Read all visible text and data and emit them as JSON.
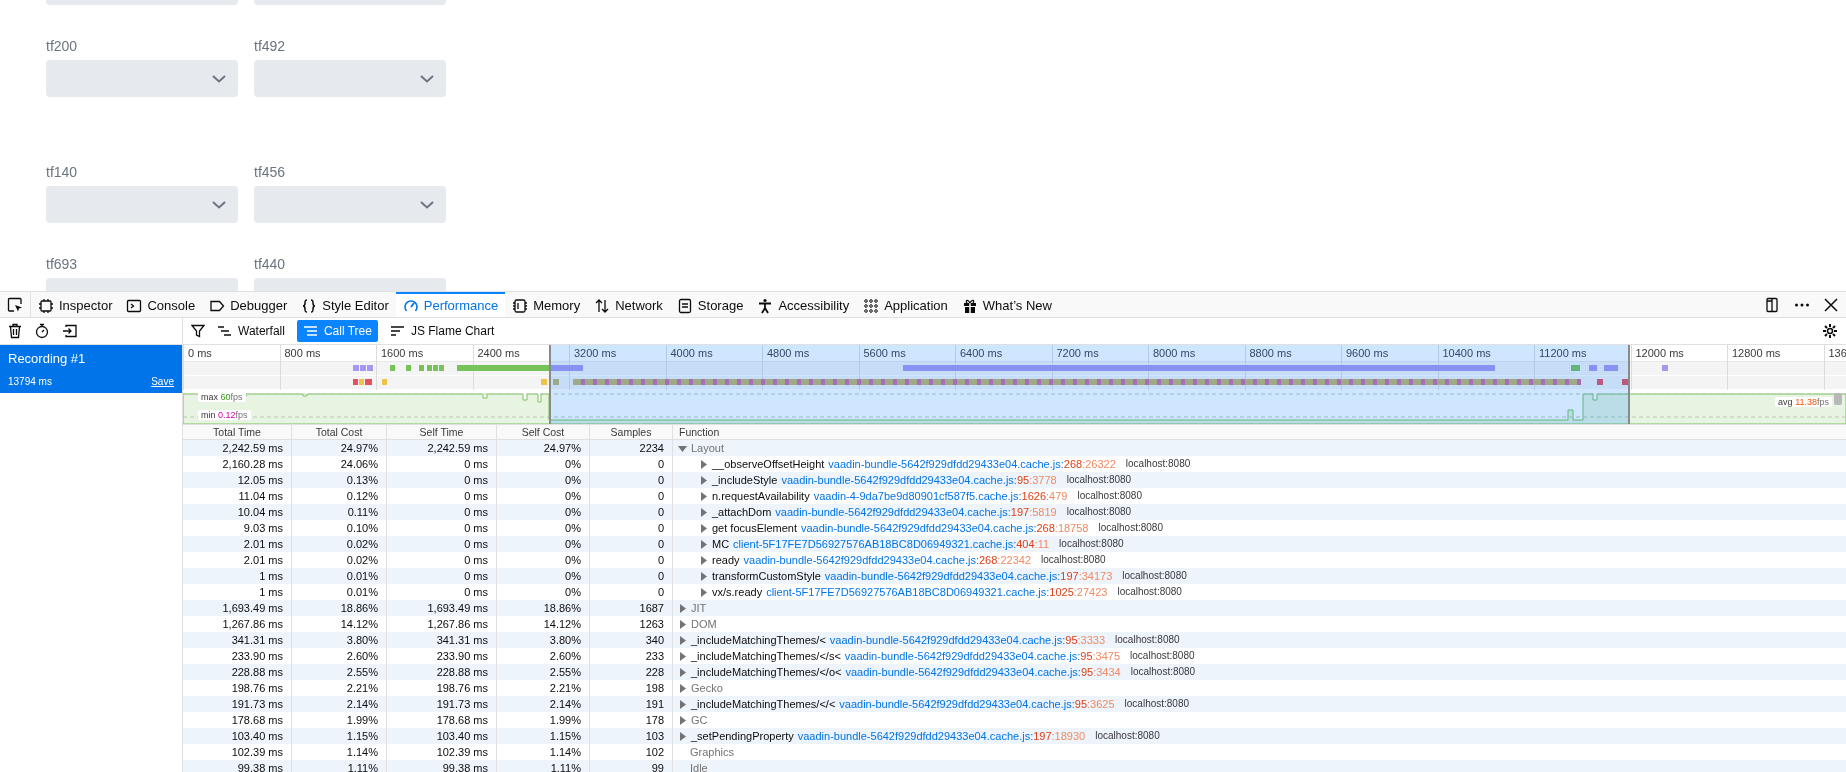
{
  "form": {
    "rows": [
      {
        "fields": [
          {
            "kind": "combo_edge"
          },
          {
            "kind": "combo_edge"
          }
        ]
      },
      {
        "fields": [
          {
            "kind": "combo",
            "label": "tf200"
          },
          {
            "kind": "combo",
            "label": "tf492"
          }
        ]
      },
      {
        "fields": [
          {
            "kind": "combo",
            "label": "tf140"
          },
          {
            "kind": "combo",
            "label": "tf456"
          }
        ]
      },
      {
        "fields": [
          {
            "kind": "combo_edge",
            "label": "tf693"
          },
          {
            "kind": "combo_edge",
            "label": "tf440"
          }
        ]
      }
    ]
  },
  "devtools": {
    "tabs": [
      {
        "label": "Inspector",
        "selected": false
      },
      {
        "label": "Console",
        "selected": false
      },
      {
        "label": "Debugger",
        "selected": false
      },
      {
        "label": "Style Editor",
        "selected": false
      },
      {
        "label": "Performance",
        "selected": true
      },
      {
        "label": "Memory",
        "selected": false
      },
      {
        "label": "Network",
        "selected": false
      },
      {
        "label": "Storage",
        "selected": false
      },
      {
        "label": "Accessibility",
        "selected": false
      },
      {
        "label": "Application",
        "selected": false
      },
      {
        "label": "What’s New",
        "selected": false
      }
    ],
    "recordings": [
      {
        "name": "Recording #1",
        "duration": "13794 ms",
        "action": "Save",
        "selected": true
      }
    ],
    "views": [
      {
        "label": "Waterfall",
        "selected": false
      },
      {
        "label": "Call Tree",
        "selected": true
      },
      {
        "label": "JS Flame Chart",
        "selected": false
      }
    ],
    "timeline": {
      "ticks": [
        "0 ms",
        "800 ms",
        "1600 ms",
        "2400 ms",
        "3200 ms",
        "4000 ms",
        "4800 ms",
        "5600 ms",
        "6400 ms",
        "7200 ms",
        "8000 ms",
        "8800 ms",
        "9600 ms",
        "10400 ms",
        "11200 ms",
        "12000 ms",
        "12800 ms",
        "136"
      ],
      "fps": {
        "max": {
          "label": "max",
          "value": "60",
          "unit": "fps"
        },
        "min": {
          "label": "min",
          "value": "0.12",
          "unit": "fps"
        },
        "avg": {
          "label": "avg",
          "value": "11.38",
          "unit": "fps"
        }
      }
    },
    "call_tree": {
      "columns": [
        "Total Time",
        "Total Cost",
        "Self Time",
        "Self Cost",
        "Samples",
        "Function"
      ],
      "rows": [
        {
          "kind": "category",
          "name": "Layout",
          "expanded": true,
          "total_time": "2,242.59 ms",
          "total_cost": "24.97%",
          "self_time": "2,242.59 ms",
          "self_cost": "24.97%",
          "samples": "2234",
          "children": [
            {
              "kind": "function",
              "name": "__observeOffsetHeight",
              "expanded": false,
              "total_time": "2,160.28 ms",
              "total_cost": "24.06%",
              "self_time": "0 ms",
              "self_cost": "0%",
              "samples": "0",
              "source": "vaadin-bundle-5642f929dfdd29433e04.cache.js:268:26322",
              "host": "localhost:8080"
            },
            {
              "kind": "function",
              "name": "_includeStyle",
              "expanded": false,
              "total_time": "12.05 ms",
              "total_cost": "0.13%",
              "self_time": "0 ms",
              "self_cost": "0%",
              "samples": "0",
              "source": "vaadin-bundle-5642f929dfdd29433e04.cache.js:95:3778",
              "host": "localhost:8080"
            },
            {
              "kind": "function",
              "name": "n.requestAvailability",
              "expanded": false,
              "total_time": "11.04 ms",
              "total_cost": "0.12%",
              "self_time": "0 ms",
              "self_cost": "0%",
              "samples": "0",
              "source": "vaadin-4-9da7be9d80901cf587f5.cache.js:1626:479",
              "host": "localhost:8080"
            },
            {
              "kind": "function",
              "name": "_attachDom",
              "expanded": false,
              "total_time": "10.04 ms",
              "total_cost": "0.11%",
              "self_time": "0 ms",
              "self_cost": "0%",
              "samples": "0",
              "source": "vaadin-bundle-5642f929dfdd29433e04.cache.js:197:5819",
              "host": "localhost:8080"
            },
            {
              "kind": "function",
              "name": "get focusElement",
              "expanded": false,
              "total_time": "9.03 ms",
              "total_cost": "0.10%",
              "self_time": "0 ms",
              "self_cost": "0%",
              "samples": "0",
              "source": "vaadin-bundle-5642f929dfdd29433e04.cache.js:268:18758",
              "host": "localhost:8080"
            },
            {
              "kind": "function",
              "name": "MC",
              "expanded": false,
              "total_time": "2.01 ms",
              "total_cost": "0.02%",
              "self_time": "0 ms",
              "self_cost": "0%",
              "samples": "0",
              "source": "client-5F17FE7D56927576AB18BC8D06949321.cache.js:404:11",
              "host": "localhost:8080"
            },
            {
              "kind": "function",
              "name": "ready",
              "expanded": false,
              "total_time": "2.01 ms",
              "total_cost": "0.02%",
              "self_time": "0 ms",
              "self_cost": "0%",
              "samples": "0",
              "source": "vaadin-bundle-5642f929dfdd29433e04.cache.js:268:22342",
              "host": "localhost:8080"
            },
            {
              "kind": "function",
              "name": "transformCustomStyle",
              "expanded": false,
              "total_time": "1 ms",
              "total_cost": "0.01%",
              "self_time": "0 ms",
              "self_cost": "0%",
              "samples": "0",
              "source": "vaadin-bundle-5642f929dfdd29433e04.cache.js:197:34173",
              "host": "localhost:8080"
            },
            {
              "kind": "function",
              "name": "vx/s.ready",
              "expanded": false,
              "total_time": "1 ms",
              "total_cost": "0.01%",
              "self_time": "0 ms",
              "self_cost": "0%",
              "samples": "0",
              "source": "client-5F17FE7D56927576AB18BC8D06949321.cache.js:1025:27423",
              "host": "localhost:8080"
            }
          ]
        },
        {
          "kind": "category",
          "name": "JIT",
          "expanded": false,
          "total_time": "1,693.49 ms",
          "total_cost": "18.86%",
          "self_time": "1,693.49 ms",
          "self_cost": "18.86%",
          "samples": "1687"
        },
        {
          "kind": "category",
          "name": "DOM",
          "expanded": false,
          "total_time": "1,267.86 ms",
          "total_cost": "14.12%",
          "self_time": "1,267.86 ms",
          "self_cost": "14.12%",
          "samples": "1263"
        },
        {
          "kind": "function",
          "name": "_includeMatchingThemes/<",
          "expanded": false,
          "total_time": "341.31 ms",
          "total_cost": "3.80%",
          "self_time": "341.31 ms",
          "self_cost": "3.80%",
          "samples": "340",
          "source": "vaadin-bundle-5642f929dfdd29433e04.cache.js:95:3333",
          "host": "localhost:8080"
        },
        {
          "kind": "function",
          "name": "_includeMatchingThemes/</s<",
          "expanded": false,
          "total_time": "233.90 ms",
          "total_cost": "2.60%",
          "self_time": "233.90 ms",
          "self_cost": "2.60%",
          "samples": "233",
          "source": "vaadin-bundle-5642f929dfdd29433e04.cache.js:95:3475",
          "host": "localhost:8080"
        },
        {
          "kind": "function",
          "name": "_includeMatchingThemes/</o<",
          "expanded": false,
          "total_time": "228.88 ms",
          "total_cost": "2.55%",
          "self_time": "228.88 ms",
          "self_cost": "2.55%",
          "samples": "228",
          "source": "vaadin-bundle-5642f929dfdd29433e04.cache.js:95:3434",
          "host": "localhost:8080"
        },
        {
          "kind": "category",
          "name": "Gecko",
          "expanded": false,
          "total_time": "198.76 ms",
          "total_cost": "2.21%",
          "self_time": "198.76 ms",
          "self_cost": "2.21%",
          "samples": "198"
        },
        {
          "kind": "function",
          "name": "_includeMatchingThemes/</<",
          "expanded": false,
          "total_time": "191.73 ms",
          "total_cost": "2.14%",
          "self_time": "191.73 ms",
          "self_cost": "2.14%",
          "samples": "191",
          "source": "vaadin-bundle-5642f929dfdd29433e04.cache.js:95:3625",
          "host": "localhost:8080"
        },
        {
          "kind": "category",
          "name": "GC",
          "expanded": false,
          "total_time": "178.68 ms",
          "total_cost": "1.99%",
          "self_time": "178.68 ms",
          "self_cost": "1.99%",
          "samples": "178"
        },
        {
          "kind": "function",
          "name": "_setPendingProperty",
          "expanded": false,
          "total_time": "103.40 ms",
          "total_cost": "1.15%",
          "self_time": "103.40 ms",
          "self_cost": "1.15%",
          "samples": "103",
          "source": "vaadin-bundle-5642f929dfdd29433e04.cache.js:197:18930",
          "host": "localhost:8080"
        },
        {
          "kind": "category",
          "name": "Graphics",
          "total_time": "102.39 ms",
          "total_cost": "1.14%",
          "self_time": "102.39 ms",
          "self_cost": "1.14%",
          "samples": "102"
        },
        {
          "kind": "category",
          "name": "Idle",
          "total_time": "99.38 ms",
          "total_cost": "1.11%",
          "self_time": "99.38 ms",
          "self_cost": "1.11%",
          "samples": "99"
        }
      ]
    }
  }
}
